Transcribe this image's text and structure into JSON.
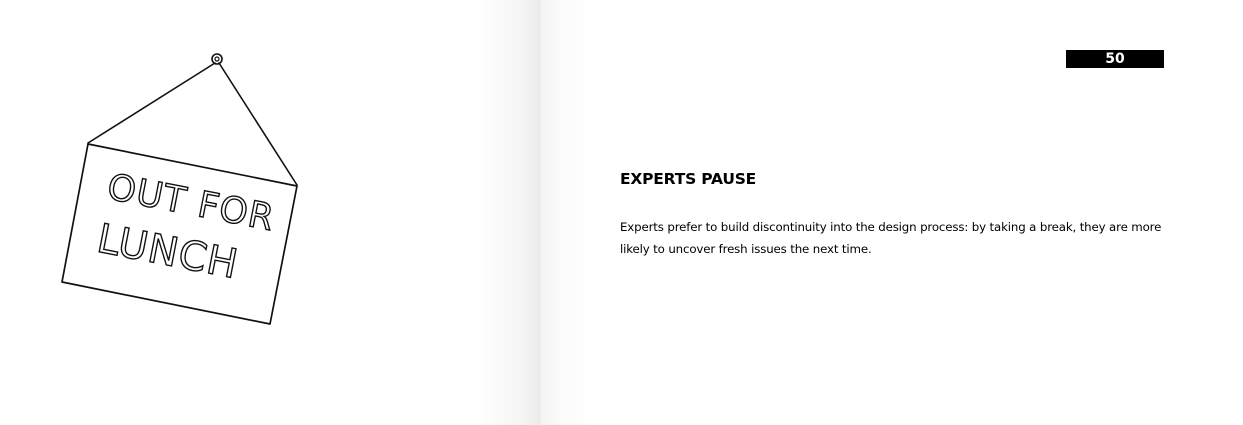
{
  "left_page": {
    "illustration": {
      "icon": "out-for-lunch-sign-icon",
      "line1": "OUT FOR",
      "line2": "LUNCH"
    }
  },
  "right_page": {
    "page_number": "50",
    "title": "EXPERTS PAUSE",
    "body": "Experts prefer to build discontinuity into the design process: by taking a break, they are more likely to uncover fresh issues the next time."
  }
}
